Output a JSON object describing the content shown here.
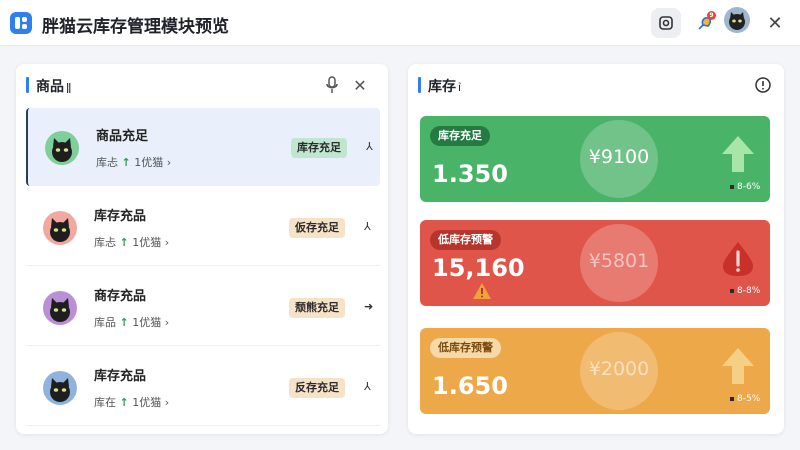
{
  "app": {
    "title": "胖猫云库存管理模块预览",
    "brand_color": "#2f80ed"
  },
  "titlebar": {
    "icons": [
      "settings-icon",
      "notification-icon",
      "user-avatar",
      "close-icon"
    ],
    "notification_badge": "9",
    "close_glyph": "✕"
  },
  "products_panel": {
    "title": "商品",
    "title_icon": "ǁ",
    "icons": [
      "microphone-icon",
      "close-icon"
    ],
    "close_glyph": "✕",
    "items": [
      {
        "name": "商品充足",
        "sub_prefix": "库忐",
        "sub_suffix": "1优猫",
        "badge": "库存充足",
        "badge_color": "#bfe7cf",
        "trailing": "⅄",
        "avatar_bg": "#7fcf9a"
      },
      {
        "name": "库存充品",
        "sub_prefix": "库忐",
        "sub_suffix": "1优猫",
        "badge": "仮存充足",
        "badge_color": "#f6e2c8",
        "trailing": "⅄",
        "avatar_bg": "#f0a8a0"
      },
      {
        "name": "商存充品",
        "sub_prefix": "库品",
        "sub_suffix": "1优猫",
        "badge": "颓熊充足",
        "badge_color": "#f6e2c8",
        "trailing": "➜",
        "avatar_bg": "#b98fd6"
      },
      {
        "name": "库存充品",
        "sub_prefix": "库在",
        "sub_suffix": "1优猫",
        "badge": "反存充足",
        "badge_color": "#f6e2c8",
        "trailing": "⅄",
        "avatar_bg": "#8fb3dd"
      }
    ],
    "up_arrow": "↑",
    "chevron": "›",
    "partial_text": "---"
  },
  "inventory_panel": {
    "title": "库存",
    "title_icon": "ỉ",
    "icons": [
      "info-icon"
    ],
    "cards": [
      {
        "label": "库存充足",
        "value": "1.350",
        "price": "¥9100",
        "delta": "8-6%",
        "color": "#49b368",
        "icon": "up-arrow-icon"
      },
      {
        "label": "低库存预警",
        "value": "15,160",
        "price": "¥5801",
        "delta": "8-8%",
        "color": "#e0554a",
        "icon": "warning-icon"
      },
      {
        "label": "低库存预警",
        "value": "1.650",
        "price": "¥2000",
        "delta": "8-5%",
        "color": "#eda849",
        "icon": "up-arrow-icon"
      }
    ]
  }
}
